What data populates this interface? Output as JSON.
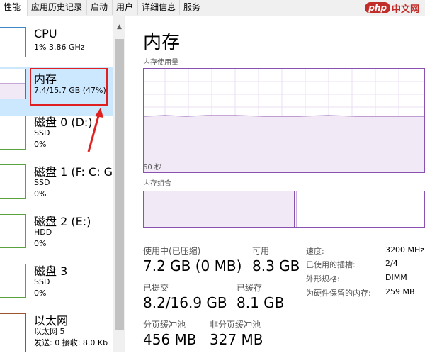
{
  "tabs": [
    {
      "label": "性能"
    },
    {
      "label": "应用历史记录"
    },
    {
      "label": "启动"
    },
    {
      "label": "用户"
    },
    {
      "label": "详细信息"
    },
    {
      "label": "服务"
    }
  ],
  "watermark": {
    "badge": "php",
    "text": "中文网"
  },
  "sidebar": {
    "items": [
      {
        "title": "CPU",
        "line1": "1% 3.86 GHz",
        "line2": "",
        "line3": ""
      },
      {
        "title": "内存",
        "line1": "7.4/15.7 GB (47%)",
        "line2": "",
        "line3": ""
      },
      {
        "title": "磁盘 0 (D:)",
        "line1": "SSD",
        "line2": "0%",
        "line3": ""
      },
      {
        "title": "磁盘 1 (F: C: G:",
        "line1": "SSD",
        "line2": "0%",
        "line3": ""
      },
      {
        "title": "磁盘 2 (E:)",
        "line1": "HDD",
        "line2": "0%",
        "line3": ""
      },
      {
        "title": "磁盘 3",
        "line1": "SSD",
        "line2": "0%",
        "line3": ""
      },
      {
        "title": "以太网",
        "line1": "以太网 5",
        "line2": "发送: 0 接收: 8.0 Kb",
        "line3": ""
      }
    ]
  },
  "main": {
    "title": "内存",
    "usage_label": "内存使用量",
    "time_label": "60 秒",
    "composition_label": "内存组合",
    "in_use_label": "使用中(已压缩)",
    "in_use_value": "7.2 GB (0 MB)",
    "available_label": "可用",
    "available_value": "8.3 GB",
    "committed_label": "已提交",
    "committed_value": "8.2/16.9 GB",
    "cached_label": "已缓存",
    "cached_value": "8.1 GB",
    "paged_label": "分页缓冲池",
    "paged_value": "456 MB",
    "nonpaged_label": "非分页缓冲池",
    "nonpaged_value": "327 MB",
    "specs": [
      {
        "label": "速度:",
        "value": "3200 MHz"
      },
      {
        "label": "已使用的插槽:",
        "value": "2/4"
      },
      {
        "label": "外形规格:",
        "value": "DIMM"
      },
      {
        "label": "为硬件保留的内存:",
        "value": "259 MB"
      }
    ]
  },
  "colors": {
    "memory": "#8b51b0",
    "disk": "#5aa340",
    "network": "#a0522d",
    "highlight": "#e02020"
  }
}
